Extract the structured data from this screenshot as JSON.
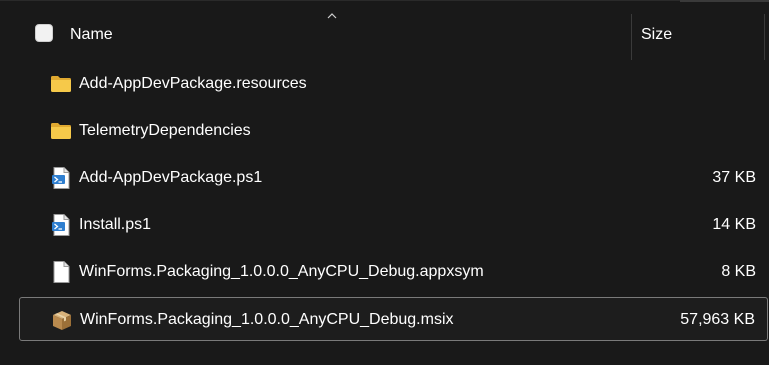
{
  "header": {
    "name_label": "Name",
    "size_label": "Size",
    "sort_direction": "ascending"
  },
  "files": [
    {
      "name": "Add-AppDevPackage.resources",
      "size": "",
      "icon": "folder-icon",
      "selected": false
    },
    {
      "name": "TelemetryDependencies",
      "size": "",
      "icon": "folder-icon",
      "selected": false
    },
    {
      "name": "Add-AppDevPackage.ps1",
      "size": "37 KB",
      "icon": "powershell-script-icon",
      "selected": false
    },
    {
      "name": "Install.ps1",
      "size": "14 KB",
      "icon": "powershell-script-icon",
      "selected": false
    },
    {
      "name": "WinForms.Packaging_1.0.0.0_AnyCPU_Debug.appxsym",
      "size": "8 KB",
      "icon": "generic-file-icon",
      "selected": false
    },
    {
      "name": "WinForms.Packaging_1.0.0.0_AnyCPU_Debug.msix",
      "size": "57,963 KB",
      "icon": "package-icon",
      "selected": true
    }
  ],
  "colors": {
    "background": "#191919",
    "text": "#ffffff",
    "folder": "#f4c542",
    "selection_border": "#7a7a7a"
  }
}
